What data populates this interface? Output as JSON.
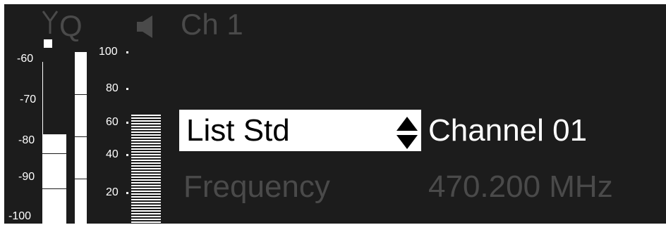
{
  "status_bar": {
    "antenna_icon": "antenna-icon",
    "q_indicator": "Q",
    "speaker_icon": "speaker-muted-icon",
    "channel": "Ch 1"
  },
  "rf_meter": {
    "scale": [
      "-60",
      "-70",
      "-80",
      "-90",
      "-100"
    ],
    "level_fraction": 0.55
  },
  "af_meter": {
    "level_fraction": 1.0
  },
  "audio_scale": {
    "scale": [
      "100",
      "80",
      "60",
      "40",
      "20"
    ],
    "level_fraction": 0.6
  },
  "menu": {
    "selected_label": "List Std",
    "selected_value": "Channel 01",
    "next_label": "Frequency",
    "next_value": "470.200 MHz",
    "up_down_icon": "up-down-arrows-icon"
  },
  "colors": {
    "background": "#1c1c1c",
    "foreground": "#ffffff",
    "dimmed": "#4a4a4a"
  }
}
